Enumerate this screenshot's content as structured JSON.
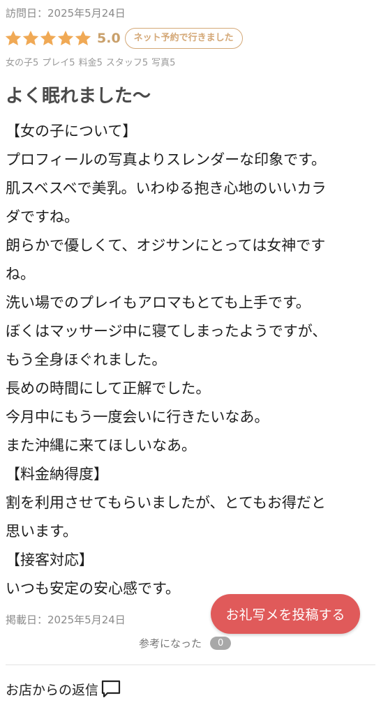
{
  "review": {
    "visit_date": "訪問日：2025年5月24日",
    "rating": {
      "stars": 5,
      "max_stars": 5,
      "score": "5.0",
      "star_color": "#f0a955"
    },
    "visit_type_badge": "ネット予約で行きました",
    "sub_scores": [
      "女の子5",
      "プレイ5",
      "料金5",
      "スタッフ5",
      "写真5"
    ],
    "title": "よく眠れました〜",
    "body_lines": [
      "【女の子について】",
      "プロフィールの写真よりスレンダーな印象です。",
      "肌スベスベで美乳。いわゆる抱き心地のいいカラ",
      "ダですね。",
      "朗らかで優しくて、オジサンにとっては女神です",
      "ね。",
      "洗い場でのプレイもアロマもとても上手です。",
      "ぼくはマッサージ中に寝てしまったようですが、",
      "もう全身ほぐれました。",
      "長めの時間にして正解でした。",
      "今月中にもう一度会いに行きたいなあ。",
      "また沖縄に来てほしいなあ。",
      "【料金納得度】",
      "割を利用させてもらいましたが、とてもお得だと",
      "思います。",
      "【接客対応】",
      "いつも安定の安心感です。"
    ],
    "posted_date": "掲載日：2025年5月24日",
    "helpful_label": "参考になった",
    "helpful_count": "0"
  },
  "actions": {
    "post_photo_button": "お礼写メを投稿する",
    "post_photo_button_color": "#e05a5a"
  },
  "shop_reply": {
    "label": "お店からの返信",
    "icon": "speech-bubble-icon"
  }
}
